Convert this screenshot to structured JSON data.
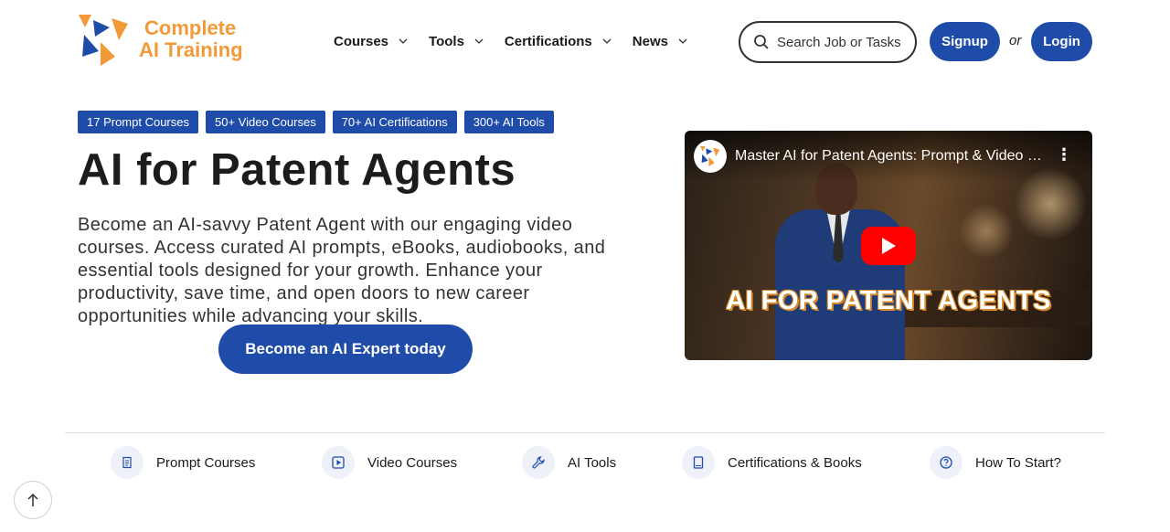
{
  "brand": {
    "line1": "Complete",
    "line2": "AI Training"
  },
  "nav": [
    {
      "label": "Courses"
    },
    {
      "label": "Tools"
    },
    {
      "label": "Certifications"
    },
    {
      "label": "News"
    }
  ],
  "search": {
    "placeholder": "Search Job or Tasks"
  },
  "auth": {
    "signup": "Signup",
    "or": "or",
    "login": "Login"
  },
  "badges": [
    "17 Prompt Courses",
    "50+ Video Courses",
    "70+ AI Certifications",
    "300+ AI Tools"
  ],
  "hero": {
    "title": "AI for Patent Agents",
    "description": "Become an AI-savvy Patent Agent with our engaging video courses. Access curated AI prompts, eBooks, audiobooks, and essential tools designed for your growth. Enhance your productivity, save time, and open doors to new career opportunities while advancing your skills.",
    "cta": "Become an AI Expert today"
  },
  "video": {
    "title": "Master AI for Patent Agents: Prompt & Video …",
    "caption": "AI FOR PATENT AGENTS"
  },
  "quick_links": [
    {
      "label": "Prompt Courses",
      "icon": "document-icon"
    },
    {
      "label": "Video Courses",
      "icon": "play-square-icon"
    },
    {
      "label": "AI Tools",
      "icon": "wrench-icon"
    },
    {
      "label": "Certifications & Books",
      "icon": "book-icon"
    },
    {
      "label": "How To Start?",
      "icon": "question-circle-icon"
    }
  ],
  "colors": {
    "primary": "#1f4ca8",
    "brand_orange": "#f29a3a",
    "brand_blue": "#1f4ca8"
  }
}
